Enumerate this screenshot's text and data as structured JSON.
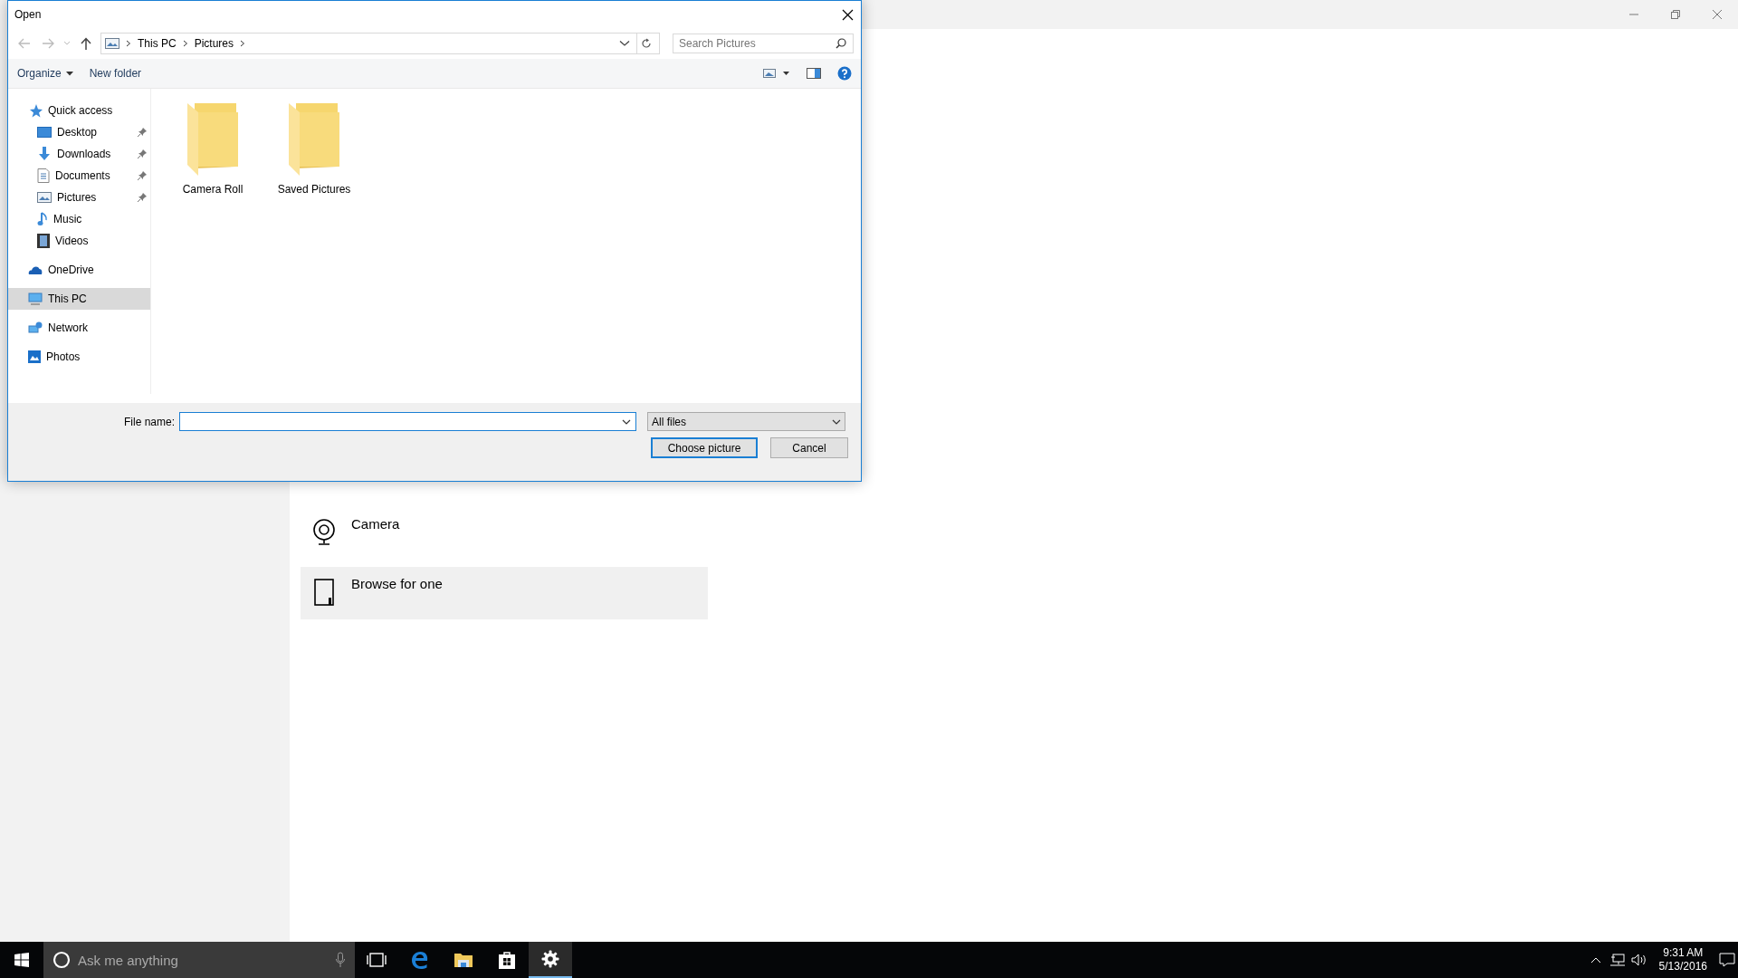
{
  "window": {
    "title": "Open"
  },
  "address_bar": {
    "path": [
      "This PC",
      "Pictures"
    ]
  },
  "search": {
    "placeholder": "Search Pictures"
  },
  "toolbar": {
    "organize": "Organize",
    "new_folder": "New folder"
  },
  "navigation": [
    {
      "label": "Quick access",
      "kind": "star",
      "selected": false,
      "children": [
        {
          "label": "Desktop",
          "kind": "desktop",
          "pinned": true
        },
        {
          "label": "Downloads",
          "kind": "downloads",
          "pinned": true
        },
        {
          "label": "Documents",
          "kind": "documents",
          "pinned": true
        },
        {
          "label": "Pictures",
          "kind": "pictures",
          "pinned": true
        },
        {
          "label": "Music",
          "kind": "music",
          "pinned": false
        },
        {
          "label": "Videos",
          "kind": "videos",
          "pinned": false
        }
      ]
    },
    {
      "label": "OneDrive",
      "kind": "cloud",
      "selected": false
    },
    {
      "label": "This PC",
      "kind": "pc",
      "selected": true
    },
    {
      "label": "Network",
      "kind": "network",
      "selected": false
    },
    {
      "label": "Photos",
      "kind": "photos",
      "selected": false
    }
  ],
  "folders": [
    {
      "name": "Camera Roll"
    },
    {
      "name": "Saved Pictures"
    }
  ],
  "file_name": {
    "label": "File name:"
  },
  "file_type": {
    "value": "All files"
  },
  "buttons": [
    {
      "label": "Choose picture",
      "kind": "primary"
    },
    {
      "label": "Cancel",
      "kind": "secondary"
    }
  ],
  "settings": {
    "options": [
      {
        "label": "Camera",
        "kind": "camera",
        "highlighted": false
      },
      {
        "label": "Browse for one",
        "kind": "browse",
        "highlighted": true
      }
    ]
  },
  "taskbar": {
    "search_placeholder": "Ask me anything",
    "apps": [
      {
        "kind": "taskview",
        "active": false
      },
      {
        "kind": "browser",
        "active": false
      },
      {
        "kind": "explorer",
        "active": false
      },
      {
        "kind": "store",
        "active": false
      },
      {
        "kind": "settings",
        "active": true
      }
    ],
    "time": "9:31 AM",
    "date": "5/13/2016"
  }
}
